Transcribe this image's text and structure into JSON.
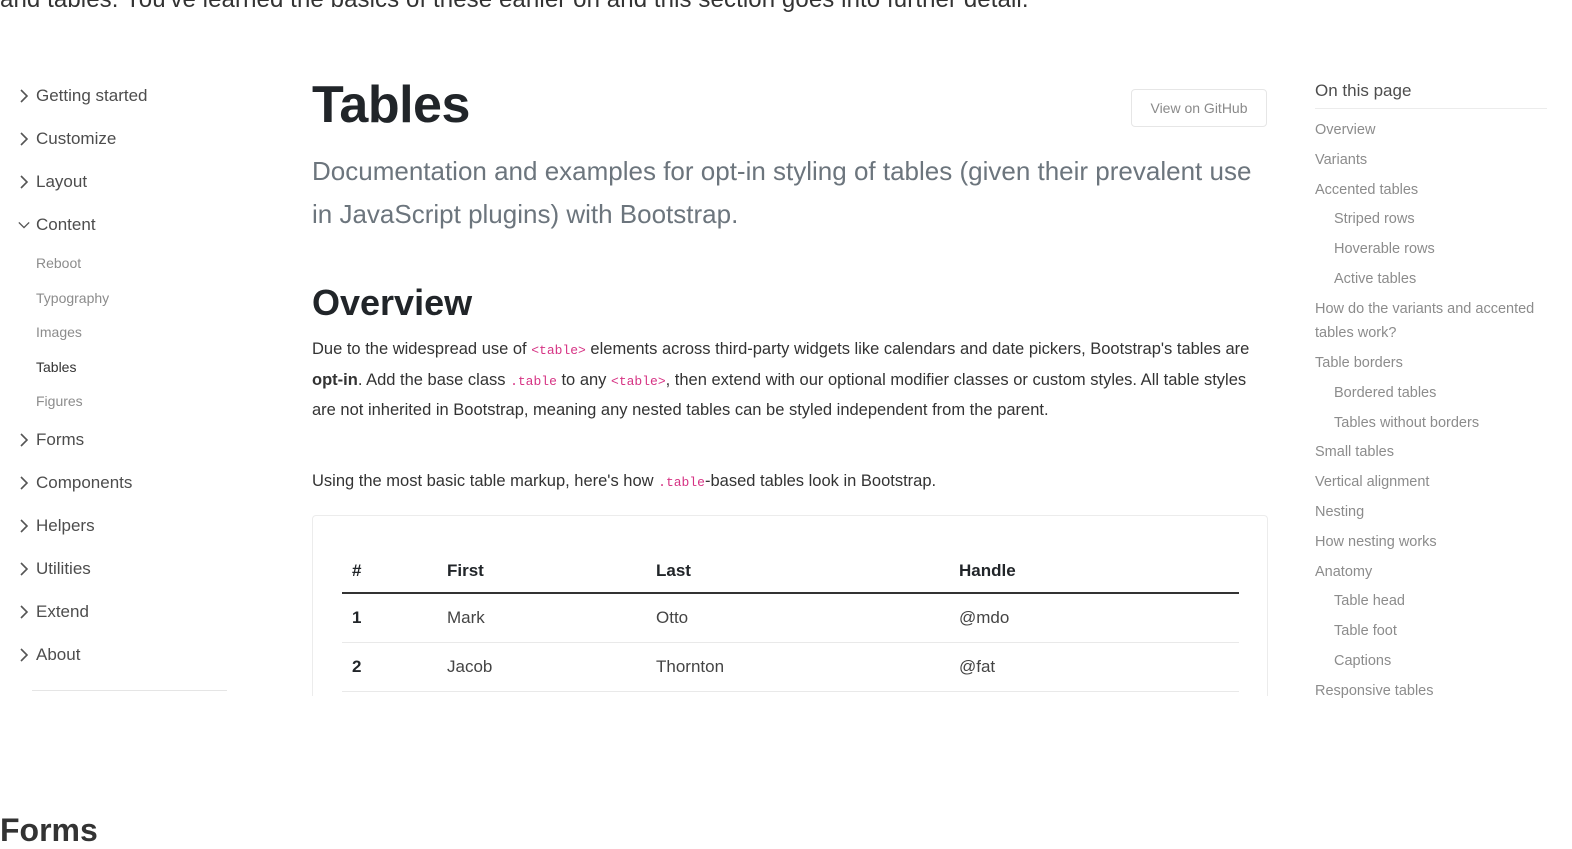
{
  "intro_text": "and tables. You've learned the basics of these earlier on and this section goes into further detail.",
  "sidebar": {
    "items_top": [
      {
        "label": "Getting started",
        "expanded": false
      },
      {
        "label": "Customize",
        "expanded": false
      },
      {
        "label": "Layout",
        "expanded": false
      },
      {
        "label": "Content",
        "expanded": true
      }
    ],
    "content_children": [
      "Reboot",
      "Typography",
      "Images",
      "Tables",
      "Figures"
    ],
    "active_child": "Tables",
    "items_bottom": [
      "Forms",
      "Components",
      "Helpers",
      "Utilities",
      "Extend",
      "About"
    ]
  },
  "main": {
    "title": "Tables",
    "github_button": "View on GitHub",
    "lead": "Documentation and examples for opt-in styling of tables (given their prevalent use in JavaScript plugins) with Bootstrap.",
    "overview_heading": "Overview",
    "p1": {
      "a": "Due to the widespread use of ",
      "code1": "<table>",
      "b": " elements across third-party widgets like calendars and date pickers, Bootstrap's tables are ",
      "strong": "opt-in",
      "c": ". Add the base class ",
      "code2": ".table",
      "d": " to any ",
      "code3": "<table>",
      "e": ", then extend with our optional modifier classes or custom styles. All table styles are not inherited in Bootstrap, meaning any nested tables can be styled independent from the parent."
    },
    "p2": {
      "a": "Using the most basic table markup, here's how ",
      "code": ".table",
      "b": "-based tables look in Bootstrap."
    },
    "table": {
      "headers": [
        "#",
        "First",
        "Last",
        "Handle"
      ],
      "rows": [
        [
          "1",
          "Mark",
          "Otto",
          "@mdo"
        ],
        [
          "2",
          "Jacob",
          "Thornton",
          "@fat"
        ]
      ]
    }
  },
  "toc": {
    "title": "On this page",
    "items": [
      {
        "label": "Overview",
        "sub": false
      },
      {
        "label": "Variants",
        "sub": false
      },
      {
        "label": "Accented tables",
        "sub": false
      },
      {
        "label": "Striped rows",
        "sub": true
      },
      {
        "label": "Hoverable rows",
        "sub": true
      },
      {
        "label": "Active tables",
        "sub": true
      },
      {
        "label": "How do the variants and accented tables work?",
        "sub": false
      },
      {
        "label": "Table borders",
        "sub": false
      },
      {
        "label": "Bordered tables",
        "sub": true
      },
      {
        "label": "Tables without borders",
        "sub": true
      },
      {
        "label": "Small tables",
        "sub": false
      },
      {
        "label": "Vertical alignment",
        "sub": false
      },
      {
        "label": "Nesting",
        "sub": false
      },
      {
        "label": "How nesting works",
        "sub": false
      },
      {
        "label": "Anatomy",
        "sub": false
      },
      {
        "label": "Table head",
        "sub": true
      },
      {
        "label": "Table foot",
        "sub": true
      },
      {
        "label": "Captions",
        "sub": true
      },
      {
        "label": "Responsive tables",
        "sub": false
      }
    ]
  },
  "next_section_heading": "Forms",
  "colors": {
    "text": "#212529",
    "muted": "#6c757d",
    "code": "#d63384",
    "nav": "#4d4d4d"
  }
}
